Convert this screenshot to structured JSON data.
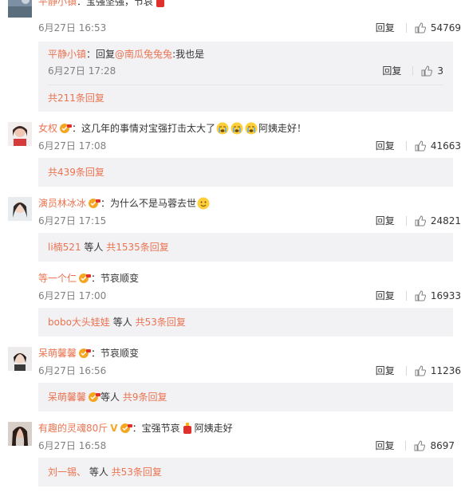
{
  "comments": [
    {
      "user": "平静小镇",
      "text": "宝强坚强，节哀",
      "time": "6月27日 16:53",
      "reply_label": "回复",
      "likes": "54769",
      "sub_reply": {
        "user": "平静小镇",
        "prefix": "回复",
        "mention": "@南瓜兔兔兔",
        "text": ":我也是",
        "time": "6月27日 17:28",
        "reply_label": "回复",
        "likes": "3"
      },
      "more": "共211条回复"
    },
    {
      "user": "女权",
      "text": "这几年的事情对宝强打击太大了",
      "text_after": "阿姨走好！",
      "time": "6月27日 17:08",
      "reply_label": "回复",
      "likes": "41663",
      "more": "共439条回复"
    },
    {
      "user": "演员林冰冰",
      "text": "为什么不是马蓉去世",
      "time": "6月27日 17:15",
      "reply_label": "回复",
      "likes": "24821",
      "more_user": "li楠521",
      "more_mid": " 等人 ",
      "more": "共1535条回复"
    },
    {
      "user": "等一个仁",
      "text": "节哀顺变",
      "time": "6月27日 17:00",
      "reply_label": "回复",
      "likes": "16933",
      "more_user": "bobo大头娃娃",
      "more_mid": " 等人 ",
      "more": "共53条回复"
    },
    {
      "user": "呆萌馨馨",
      "text": "节哀顺变",
      "time": "6月27日 16:56",
      "reply_label": "回复",
      "likes": "11236",
      "more_user": "呆萌馨馨",
      "more_mid": "等人 ",
      "more": "共9条回复"
    },
    {
      "user": "有趣的灵魂80斤",
      "text": "宝强节哀",
      "text_after": "阿姨走好",
      "time": "6月27日 16:58",
      "reply_label": "回复",
      "likes": "8697",
      "more_user": "刘一锡、",
      "more_mid": " 等人 ",
      "more": "共53条回复"
    }
  ],
  "colors": {
    "link": "#eb7350",
    "reply_bg": "#f2f2f5",
    "muted": "#808080",
    "badge": "#f5a623"
  },
  "icons": [
    "avatar",
    "member-badge-icon",
    "thumb-up-icon",
    "crying-emoji-icon",
    "smile-emoji-icon",
    "candle-emoji-icon",
    "verified-v-icon"
  ]
}
